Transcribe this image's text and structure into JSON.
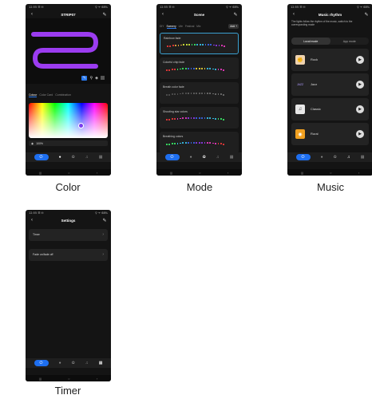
{
  "common": {
    "status_left": "12:55 ☰ ✉",
    "status_right": "⚲ ᯤ 68%",
    "edit_icon": "pencil-icon",
    "back_icon": "back-arrow-icon",
    "nav_power": "⏻",
    "sys_nav": [
      "|||",
      "○",
      "‹"
    ]
  },
  "color_screen": {
    "caption": "Color",
    "title": "STRIP07",
    "tabs": [
      "Colour",
      "Color Card",
      "Combination"
    ],
    "brightness": "100%",
    "strip_color": "#9b3cf0"
  },
  "mode_screen": {
    "caption": "Mode",
    "title": "Scene",
    "tabs": [
      "DIY",
      "Scenery",
      "Life",
      "Festival",
      "Mix"
    ],
    "add_label": "Add +",
    "cards": [
      {
        "name": "Rainbow fade",
        "selected": true,
        "colors": [
          "#ff3b3b",
          "#ffb13b",
          "#e6ff3b",
          "#3bff6e",
          "#3bd2ff",
          "#3b6eff",
          "#9b3bff",
          "#ff3bd2"
        ]
      },
      {
        "name": "Colorful chip fade",
        "selected": false,
        "colors": [
          "#ff3b3b",
          "#3bff6e",
          "#3b6eff",
          "#ffe63b",
          "#3bd2ff",
          "#ff3bd2"
        ]
      },
      {
        "name": "Breath color fade",
        "selected": false,
        "colors": [
          "#555555",
          "#666666",
          "#777777"
        ]
      },
      {
        "name": "Shooting star colors",
        "selected": false,
        "colors": [
          "#ff3b3b",
          "#ff3bd2",
          "#9b3bff",
          "#3b6eff",
          "#3bd2ff",
          "#3bff6e"
        ]
      },
      {
        "name": "Breathing colors",
        "selected": false,
        "colors": [
          "#3bff6e",
          "#3bd2ff",
          "#3b6eff",
          "#9b3bff",
          "#ff3bd2",
          "#ff3b3b"
        ]
      }
    ]
  },
  "music_screen": {
    "caption": "Music",
    "title": "Music rhythm",
    "hint": "The lights follow the rhythm of the music, switch to the corresponding mode",
    "segments": [
      "Local mode",
      "App mode"
    ],
    "items": [
      {
        "name": "Rock",
        "icon": "rock-hand-icon",
        "glyph": "✊",
        "bg": "#f0d3b0"
      },
      {
        "name": "Jazz",
        "icon": "jazz-icon",
        "glyph": "JAZZ",
        "bg": "#232323"
      },
      {
        "name": "Classic",
        "icon": "piano-icon",
        "glyph": "♫",
        "bg": "#e8e8e8"
      },
      {
        "name": "Rural",
        "icon": "disc-icon",
        "glyph": "◉",
        "bg": "#f0a020"
      }
    ]
  },
  "timer_screen": {
    "caption": "Timer",
    "title": "Settings",
    "rows": [
      "Timer",
      "Fade on/fade off"
    ]
  }
}
